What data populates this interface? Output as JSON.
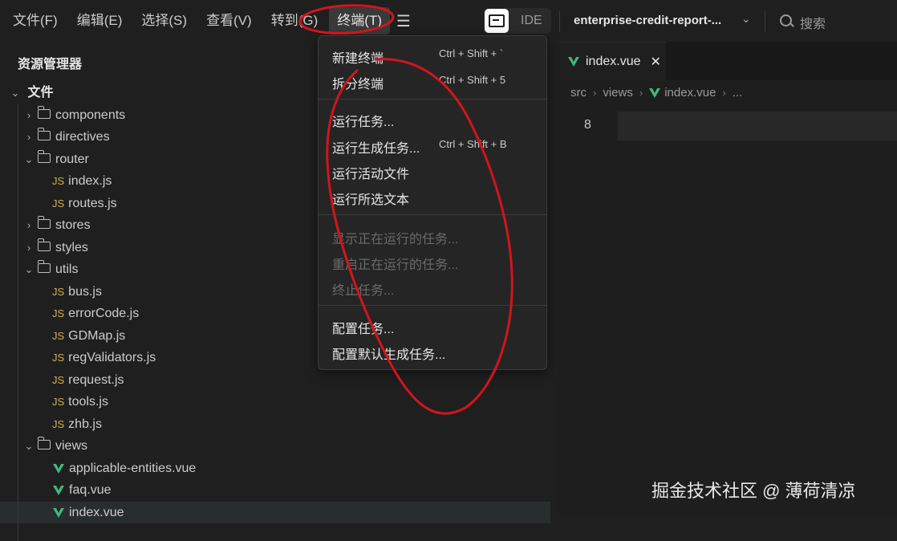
{
  "menubar": {
    "items": [
      "文件(F)",
      "编辑(E)",
      "选择(S)",
      "查看(V)",
      "转到(G)",
      "终端(T)"
    ],
    "active_item": "终端(T)",
    "ide_label": "IDE",
    "project_name": "enterprise-credit-report-...",
    "search_label": "搜索"
  },
  "sidebar": {
    "title": "资源管理器",
    "root_label": "文件",
    "tree": [
      {
        "label": "components",
        "type": "folder",
        "expanded": false,
        "level": 1
      },
      {
        "label": "directives",
        "type": "folder",
        "expanded": false,
        "level": 1
      },
      {
        "label": "router",
        "type": "folder",
        "expanded": true,
        "level": 1
      },
      {
        "label": "index.js",
        "type": "js",
        "level": 2
      },
      {
        "label": "routes.js",
        "type": "js",
        "level": 2
      },
      {
        "label": "stores",
        "type": "folder",
        "expanded": false,
        "level": 1
      },
      {
        "label": "styles",
        "type": "folder",
        "expanded": false,
        "level": 1
      },
      {
        "label": "utils",
        "type": "folder",
        "expanded": true,
        "level": 1
      },
      {
        "label": "bus.js",
        "type": "js",
        "level": 2
      },
      {
        "label": "errorCode.js",
        "type": "js",
        "level": 2
      },
      {
        "label": "GDMap.js",
        "type": "js",
        "level": 2
      },
      {
        "label": "regValidators.js",
        "type": "js",
        "level": 2
      },
      {
        "label": "request.js",
        "type": "js",
        "level": 2
      },
      {
        "label": "tools.js",
        "type": "js",
        "level": 2
      },
      {
        "label": "zhb.js",
        "type": "js",
        "level": 2
      },
      {
        "label": "views",
        "type": "folder",
        "expanded": true,
        "level": 1
      },
      {
        "label": "applicable-entities.vue",
        "type": "vue",
        "level": 2
      },
      {
        "label": "faq.vue",
        "type": "vue",
        "level": 2
      },
      {
        "label": "index.vue",
        "type": "vue",
        "level": 2,
        "selected": true
      }
    ]
  },
  "terminal_menu": {
    "items": [
      {
        "label": "新建终端",
        "shortcut": "Ctrl + Shift + `",
        "disabled": false
      },
      {
        "label": "拆分终端",
        "shortcut": "Ctrl + Shift + 5",
        "disabled": false
      },
      {
        "label": "运行任务...",
        "shortcut": "",
        "disabled": false
      },
      {
        "label": "运行生成任务...",
        "shortcut": "Ctrl + Shift + B",
        "disabled": false
      },
      {
        "label": "运行活动文件",
        "shortcut": "",
        "disabled": false
      },
      {
        "label": "运行所选文本",
        "shortcut": "",
        "disabled": false
      },
      {
        "label": "显示正在运行的任务...",
        "shortcut": "",
        "disabled": true
      },
      {
        "label": "重启正在运行的任务...",
        "shortcut": "",
        "disabled": true
      },
      {
        "label": "终止任务...",
        "shortcut": "",
        "disabled": true
      },
      {
        "label": "配置任务...",
        "shortcut": "",
        "disabled": false
      },
      {
        "label": "配置默认生成任务...",
        "shortcut": "",
        "disabled": false
      }
    ]
  },
  "editor": {
    "tab_label": "index.vue",
    "breadcrumb": [
      "src",
      "views",
      "index.vue",
      "..."
    ],
    "line_number": "8"
  },
  "watermark": "掘金技术社区 @ 薄荷清凉",
  "colors": {
    "annotation": "#d0161c",
    "vue": "#41b883",
    "js": "#d4b04a"
  }
}
